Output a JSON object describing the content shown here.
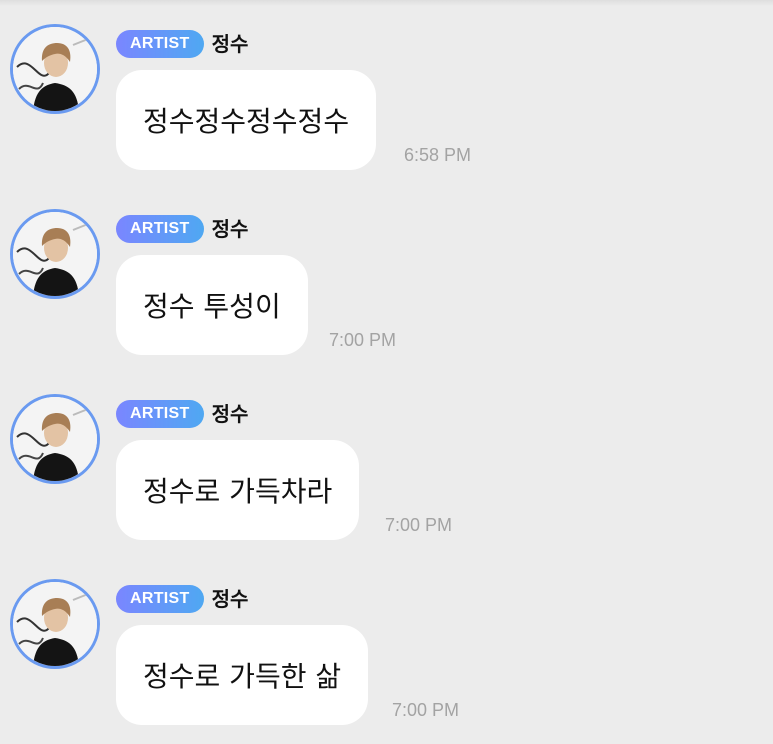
{
  "messages": [
    {
      "badge": "ARTIST",
      "sender": "정수",
      "text": "정수정수정수정수",
      "time": "6:58 PM"
    },
    {
      "badge": "ARTIST",
      "sender": "정수",
      "text": "정수 투성이",
      "time": "7:00 PM"
    },
    {
      "badge": "ARTIST",
      "sender": "정수",
      "text": "정수로 가득차라",
      "time": "7:00 PM"
    },
    {
      "badge": "ARTIST",
      "sender": "정수",
      "text": "정수로 가득한 삶",
      "time": "7:00 PM"
    }
  ],
  "colors": {
    "background": "#ececec",
    "bubble": "#ffffff",
    "badge_start": "#7a86ff",
    "badge_end": "#4fa8f2",
    "avatar_ring": "#6a9af0",
    "timestamp": "#a3a3a3"
  },
  "icons": {
    "avatar": "user-photo-avatar"
  }
}
